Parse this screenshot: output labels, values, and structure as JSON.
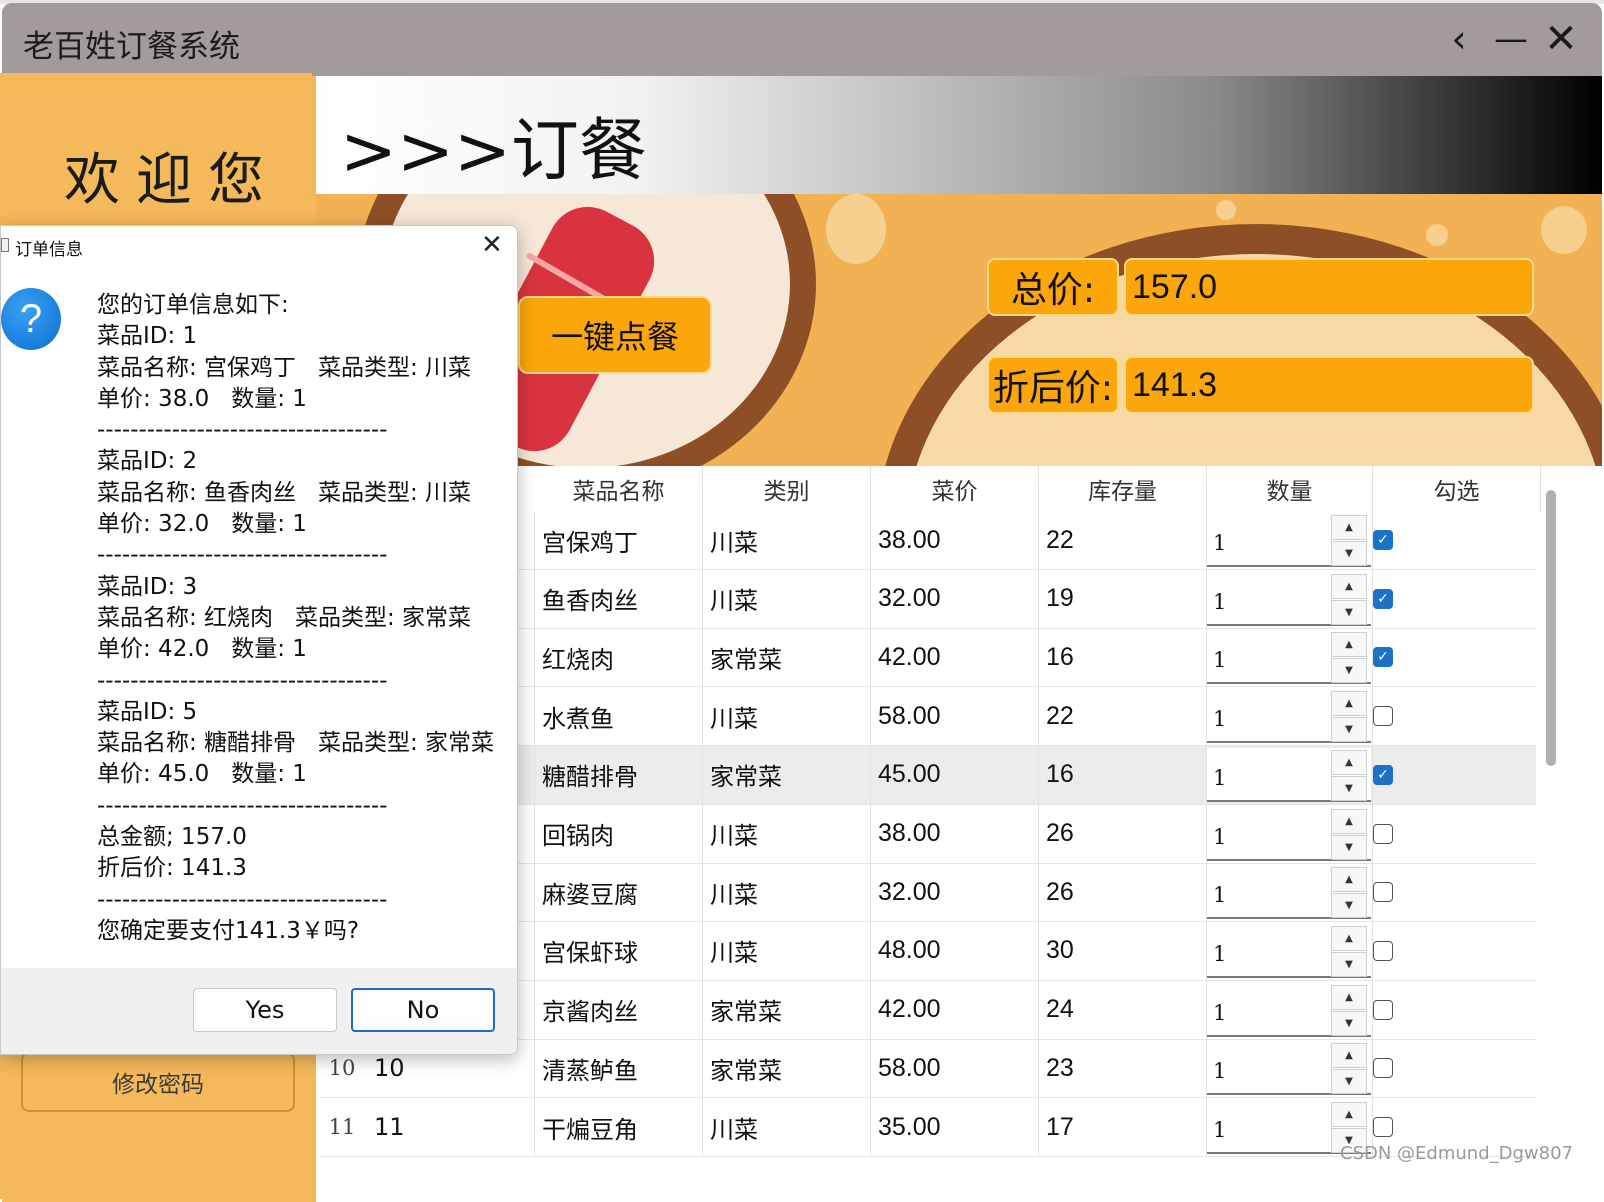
{
  "window": {
    "title": "老百姓订餐系统",
    "back_icon": "‹",
    "minimize_icon": "—",
    "close_icon": "✕"
  },
  "sidebar": {
    "welcome": "欢迎您",
    "change_password": "修改密码"
  },
  "header": {
    "title": ">>>订餐"
  },
  "banner": {
    "total_label": "总价:",
    "total_value": "157.0",
    "discount_label": "折后价:",
    "discount_value": "141.3",
    "quick_order": "一键点餐"
  },
  "table": {
    "columns": [
      "菜品名称",
      "类别",
      "菜价",
      "库存量",
      "数量",
      "勾选"
    ],
    "rows": [
      {
        "row": "",
        "id": "",
        "name": "宫保鸡丁",
        "category": "川菜",
        "price": "38.00",
        "stock": "22",
        "qty": "1",
        "checked": true
      },
      {
        "row": "",
        "id": "",
        "name": "鱼香肉丝",
        "category": "川菜",
        "price": "32.00",
        "stock": "19",
        "qty": "1",
        "checked": true
      },
      {
        "row": "",
        "id": "",
        "name": "红烧肉",
        "category": "家常菜",
        "price": "42.00",
        "stock": "16",
        "qty": "1",
        "checked": true
      },
      {
        "row": "",
        "id": "",
        "name": "水煮鱼",
        "category": "川菜",
        "price": "58.00",
        "stock": "22",
        "qty": "1",
        "checked": false
      },
      {
        "row": "",
        "id": "",
        "name": "糖醋排骨",
        "category": "家常菜",
        "price": "45.00",
        "stock": "16",
        "qty": "1",
        "checked": true
      },
      {
        "row": "",
        "id": "",
        "name": "回锅肉",
        "category": "川菜",
        "price": "38.00",
        "stock": "26",
        "qty": "1",
        "checked": false
      },
      {
        "row": "",
        "id": "",
        "name": "麻婆豆腐",
        "category": "川菜",
        "price": "32.00",
        "stock": "26",
        "qty": "1",
        "checked": false
      },
      {
        "row": "",
        "id": "",
        "name": "宫保虾球",
        "category": "川菜",
        "price": "48.00",
        "stock": "30",
        "qty": "1",
        "checked": false
      },
      {
        "row": "",
        "id": "",
        "name": "京酱肉丝",
        "category": "家常菜",
        "price": "42.00",
        "stock": "24",
        "qty": "1",
        "checked": false
      },
      {
        "row": "10",
        "id": "10",
        "name": "清蒸鲈鱼",
        "category": "家常菜",
        "price": "58.00",
        "stock": "23",
        "qty": "1",
        "checked": false
      },
      {
        "row": "11",
        "id": "11",
        "name": "干煸豆角",
        "category": "川菜",
        "price": "35.00",
        "stock": "17",
        "qty": "1",
        "checked": false
      }
    ]
  },
  "dialog": {
    "title": "订单信息",
    "close_icon": "✕",
    "icon": "?",
    "body": "您的订单信息如下:\n菜品ID: 1\n菜品名称: 宫保鸡丁   菜品类型: 川菜\n单价: 38.0   数量: 1\n-----------------------------------\n菜品ID: 2\n菜品名称: 鱼香肉丝   菜品类型: 川菜\n单价: 32.0   数量: 1\n-----------------------------------\n菜品ID: 3\n菜品名称: 红烧肉   菜品类型: 家常菜\n单价: 42.0   数量: 1\n-----------------------------------\n菜品ID: 5\n菜品名称: 糖醋排骨   菜品类型: 家常菜\n单价: 45.0   数量: 1\n-----------------------------------\n总金额; 157.0\n折后价: 141.3\n-----------------------------------\n您确定要支付141.3￥吗?",
    "yes": "Yes",
    "no": "No"
  },
  "watermark": "CSDN @Edmund_Dgw807"
}
